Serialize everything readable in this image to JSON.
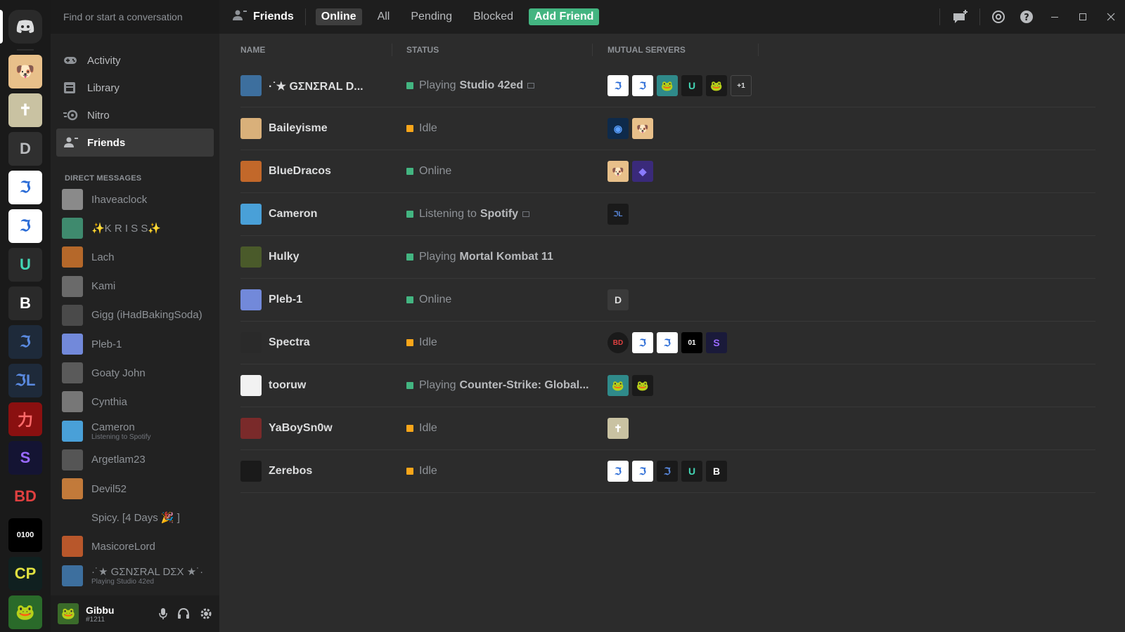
{
  "search": {
    "placeholder": "Find or start a conversation"
  },
  "nav": [
    {
      "label": "Activity"
    },
    {
      "label": "Library"
    },
    {
      "label": "Nitro"
    },
    {
      "label": "Friends"
    }
  ],
  "dm_header": "DIRECT MESSAGES",
  "dms": [
    {
      "name": "Ihaveaclock",
      "color": "#8a8a8a"
    },
    {
      "name": "✨K R I S S✨",
      "color": "#3f8a6e"
    },
    {
      "name": "Lach",
      "color": "#b5682a"
    },
    {
      "name": "Kami",
      "color": "#6a6a6a"
    },
    {
      "name": "Gigg (iHadBakingSoda)",
      "color": "#4a4a4a"
    },
    {
      "name": "Pleb-1",
      "color": "#7289da"
    },
    {
      "name": "Goaty John",
      "color": "#5a5a5a"
    },
    {
      "name": "Cynthia",
      "color": "#777777"
    },
    {
      "name": "Cameron",
      "sub": "Listening to Spotify",
      "color": "#49a0d8"
    },
    {
      "name": "Argetlam23",
      "color": "#555555"
    },
    {
      "name": "Devil52",
      "color": "#c27a3a"
    },
    {
      "name": "Spicy. [4 Days 🎉 ]",
      "color": "#222222"
    },
    {
      "name": "MasicoreLord",
      "color": "#b8572b"
    },
    {
      "name": "·˙★ GΣNΣRAL DΣX ★˙·",
      "sub": "Playing Studio 42ed",
      "color": "#3d6f9e"
    }
  ],
  "user": {
    "name": "Gibbu",
    "tag": "#1211"
  },
  "topbar": {
    "title": "Friends",
    "tabs": [
      "Online",
      "All",
      "Pending",
      "Blocked"
    ],
    "add_friend": "Add Friend"
  },
  "columns": [
    "NAME",
    "STATUS",
    "MUTUAL SERVERS"
  ],
  "colors": {
    "online": "#43b581",
    "idle": "#faa61a",
    "accent": "#43b581"
  },
  "friends": [
    {
      "name": "·˙★ GΣNΣRAL D...",
      "status_prefix": "Playing",
      "status_bold": "Studio 42ed",
      "state": "online",
      "rich": true,
      "av": "#3d6f9e",
      "mutual": [
        {
          "label": "ℑ",
          "bg": "#ffffff",
          "fg": "#2b6cd6"
        },
        {
          "label": "ℑ",
          "bg": "#ffffff",
          "fg": "#2b6cd6"
        },
        {
          "label": "🐸",
          "bg": "#2f8a8a",
          "fg": "#fff"
        },
        {
          "label": "U",
          "bg": "#1a1a1a",
          "fg": "#43d6b5"
        },
        {
          "label": "🐸",
          "bg": "#1a1a1a",
          "fg": "#fff"
        }
      ],
      "more": "+1"
    },
    {
      "name": "Baileyisme",
      "status_prefix": "Idle",
      "status_bold": "",
      "state": "idle",
      "av": "#d9b07a",
      "mutual": [
        {
          "label": "◉",
          "bg": "#0e2a4a",
          "fg": "#5aa0ff"
        },
        {
          "label": "🐶",
          "bg": "#e8c08a",
          "fg": "#fff"
        }
      ]
    },
    {
      "name": "BlueDracos",
      "status_prefix": "Online",
      "status_bold": "",
      "state": "online",
      "av": "#c2682a",
      "mutual": [
        {
          "label": "🐶",
          "bg": "#e8c08a",
          "fg": "#fff"
        },
        {
          "label": "◆",
          "bg": "#3a2a7a",
          "fg": "#8a7aff"
        }
      ]
    },
    {
      "name": "Cameron",
      "status_prefix": "Listening to",
      "status_bold": "Spotify",
      "state": "online",
      "rich": true,
      "av": "#49a0d8",
      "mutual": [
        {
          "label": "ℑL",
          "bg": "#1a1a1a",
          "fg": "#5a8ae0"
        }
      ]
    },
    {
      "name": "Hulky",
      "status_prefix": "Playing",
      "status_bold": "Mortal Kombat 11",
      "state": "online",
      "av": "#4a5a2a",
      "mutual": []
    },
    {
      "name": "Pleb-1",
      "status_prefix": "Online",
      "status_bold": "",
      "state": "online",
      "av": "#7289da",
      "mutual": [
        {
          "label": "D",
          "bg": "#3a3a3a",
          "fg": "#ddd"
        }
      ]
    },
    {
      "name": "Spectra",
      "status_prefix": "Idle",
      "status_bold": "",
      "state": "idle",
      "av": "#2a2a2a",
      "mutual": [
        {
          "label": "BD",
          "bg": "#1a1a1a",
          "fg": "#e04040"
        },
        {
          "label": "ℑ",
          "bg": "#ffffff",
          "fg": "#2b6cd6"
        },
        {
          "label": "ℑ",
          "bg": "#ffffff",
          "fg": "#2b6cd6"
        },
        {
          "label": "01",
          "bg": "#000000",
          "fg": "#fff"
        },
        {
          "label": "S",
          "bg": "#1a1a3a",
          "fg": "#9a6aff"
        }
      ]
    },
    {
      "name": "tooruw",
      "status_prefix": "Playing",
      "status_bold": "Counter-Strike: Global...",
      "state": "online",
      "av": "#f2f2f2",
      "mutual": [
        {
          "label": "🐸",
          "bg": "#2f8a8a",
          "fg": "#fff"
        },
        {
          "label": "🐸",
          "bg": "#1a1a1a",
          "fg": "#fff"
        }
      ]
    },
    {
      "name": "YaBoySn0w",
      "status_prefix": "Idle",
      "status_bold": "",
      "state": "idle",
      "av": "#7a2a2a",
      "mutual": [
        {
          "label": "✝",
          "bg": "#c9c2a2",
          "fg": "#fff"
        }
      ]
    },
    {
      "name": "Zerebos",
      "status_prefix": "Idle",
      "status_bold": "",
      "state": "idle",
      "av": "#1a1a1a",
      "mutual": [
        {
          "label": "ℑ",
          "bg": "#ffffff",
          "fg": "#2b6cd6"
        },
        {
          "label": "ℑ",
          "bg": "#ffffff",
          "fg": "#2b6cd6"
        },
        {
          "label": "ℑ",
          "bg": "#1a1a1a",
          "fg": "#5a8ae0"
        },
        {
          "label": "U",
          "bg": "#1a1a1a",
          "fg": "#43d6b5"
        },
        {
          "label": "B",
          "bg": "#1a1a1a",
          "fg": "#ffffff"
        }
      ]
    }
  ],
  "servers": [
    {
      "label": "🐶",
      "bg": "#e8c08a",
      "fg": "#fff"
    },
    {
      "label": "✝",
      "bg": "#c9c2a2",
      "fg": "#fff"
    },
    {
      "label": "D",
      "bg": "#2f2f2f",
      "fg": "#b9bbbe"
    },
    {
      "label": "ℑ",
      "bg": "#ffffff",
      "fg": "#2b6cd6"
    },
    {
      "label": "ℑ",
      "bg": "#ffffff",
      "fg": "#2b6cd6"
    },
    {
      "label": "U",
      "bg": "#2a2a2a",
      "fg": "#43d6b5"
    },
    {
      "label": "B",
      "bg": "#2a2a2a",
      "fg": "#ffffff"
    },
    {
      "label": "ℑ",
      "bg": "#1e2a3a",
      "fg": "#5a8ae0"
    },
    {
      "label": "ℑL",
      "bg": "#1e2a3a",
      "fg": "#5a8ae0"
    },
    {
      "label": "力",
      "bg": "#8a1010",
      "fg": "#ff6a6a"
    },
    {
      "label": "S",
      "bg": "#141433",
      "fg": "#9a6aff"
    },
    {
      "label": "BD",
      "bg": "#1a1a1a",
      "fg": "#e04040"
    },
    {
      "label": "0100",
      "bg": "#000000",
      "fg": "#ffffff"
    },
    {
      "label": "CP",
      "bg": "#102020",
      "fg": "#e0e040"
    },
    {
      "label": "🐸",
      "bg": "#2a6a2a",
      "fg": "#ffffff"
    }
  ]
}
